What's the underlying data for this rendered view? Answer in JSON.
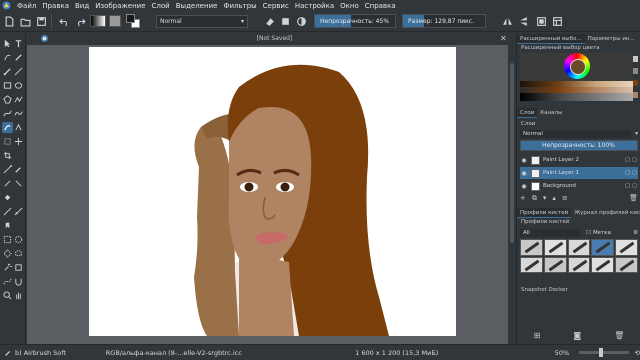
{
  "menu": {
    "items": [
      {
        "label": "Файл"
      },
      {
        "label": "Правка"
      },
      {
        "label": "Вид"
      },
      {
        "label": "Изображение"
      },
      {
        "label": "Слой"
      },
      {
        "label": "Выделение"
      },
      {
        "label": "Фильтры"
      },
      {
        "label": "Сервис"
      },
      {
        "label": "Настройка"
      },
      {
        "label": "Окно"
      },
      {
        "label": "Справка"
      }
    ]
  },
  "toolbar": {
    "blend_mode": "Normal",
    "opacity_label": "Непрозрачность: 45%",
    "opacity_value": 45,
    "size_label": "Размер: 129,87 пикс.",
    "size_value": 129.87
  },
  "document": {
    "tab_title": "[Not Saved]"
  },
  "docker": {
    "color_tabs": [
      "Расширенный выбо...",
      "Параметры ин..."
    ],
    "color_title": "Расширенный выбор цвета",
    "layer_tabs": [
      "Слои",
      "Каналы"
    ],
    "layers_title": "Слои",
    "layer_blend": "Normal",
    "layer_opacity_label": "Непрозрачность:  100%",
    "layers": [
      {
        "name": "Paint Layer 2",
        "selected": false
      },
      {
        "name": "Paint Layer 1",
        "selected": true
      },
      {
        "name": "Background",
        "selected": false
      }
    ],
    "preset_tabs": [
      "Профили кистей",
      "Журнал профилей кистей"
    ],
    "presets_title": "Профили кистей",
    "preset_filter": "All",
    "preset_tag_label": "Метка",
    "snapshot_title": "Snapshot Docker"
  },
  "status": {
    "brush": "b) Airbrush Soft",
    "colorspace": "RGB/альфа-канал (8-...elle-V2-srgbtrc.icc",
    "dimensions": "1 600 x 1 200 (15,3 МиБ)",
    "zoom": "50%"
  },
  "colors": {
    "accent": "#3d6f9b",
    "hair": "#7a3f0b",
    "skin": "#b08363",
    "arm": "#9a7048"
  }
}
